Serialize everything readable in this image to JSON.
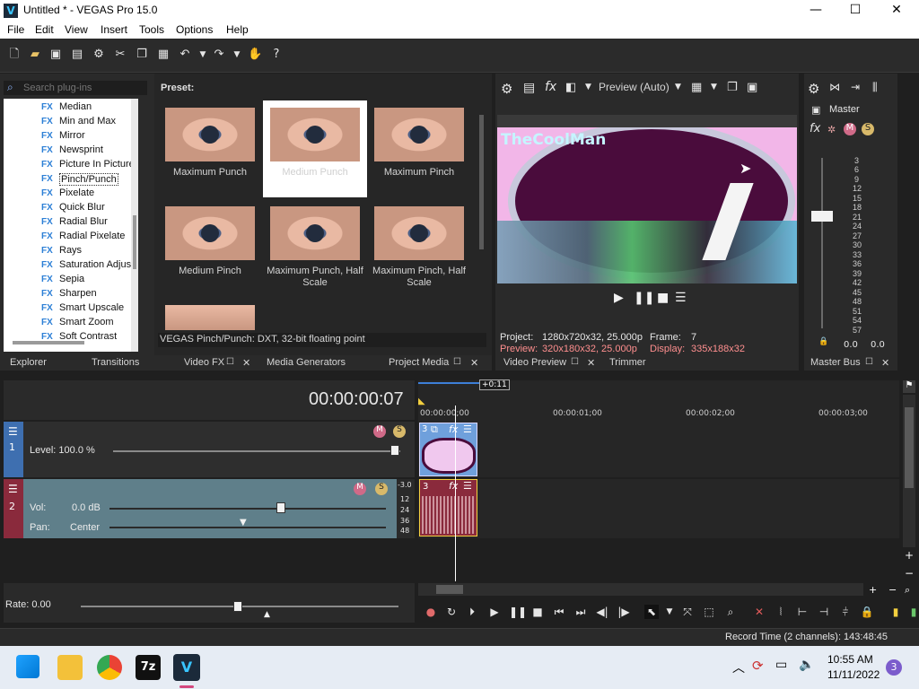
{
  "window": {
    "title": "Untitled * - VEGAS Pro 15.0",
    "logo_letter": "V",
    "controls": {
      "minimize": "—",
      "maximize": "☐",
      "close": "✕"
    }
  },
  "menu": [
    "File",
    "Edit",
    "View",
    "Insert",
    "Tools",
    "Options",
    "Help"
  ],
  "plugins": {
    "search_placeholder": "Search plug-ins",
    "fx_badge": "FX",
    "items": [
      "Median",
      "Min and Max",
      "Mirror",
      "Newsprint",
      "Picture In Picture",
      "Pinch/Punch",
      "Pixelate",
      "Quick Blur",
      "Radial Blur",
      "Radial Pixelate",
      "Rays",
      "Saturation Adjust",
      "Sepia",
      "Sharpen",
      "Smart Upscale",
      "Smart Zoom",
      "Soft Contrast"
    ],
    "selected": "Pinch/Punch"
  },
  "presets": {
    "header": "Preset:",
    "tiles": [
      "Maximum Punch",
      "Medium Punch",
      "Maximum Pinch",
      "Medium Pinch",
      "Maximum Punch, Half Scale",
      "Maximum Pinch, Half Scale"
    ],
    "selected": "Medium Punch",
    "status": "VEGAS Pinch/Punch: DXT, 32-bit floating point"
  },
  "bottom_tabs_left": [
    "Explorer",
    "Transitions",
    "Video FX",
    "Media Generators",
    "Project Media"
  ],
  "preview": {
    "quality": "Preview (Auto)",
    "overlay_text": "TheCoolMan",
    "project_label": "Project:",
    "project_value": "1280x720x32, 25.000p",
    "preview_label": "Preview:",
    "preview_value": "320x180x32, 25.000p",
    "frame_label": "Frame:",
    "frame_value": "7",
    "display_label": "Display:",
    "display_value": "335x188x32",
    "tabs": [
      "Video Preview",
      "Trimmer"
    ]
  },
  "master": {
    "label": "Master",
    "scale": [
      "3",
      "6",
      "9",
      "12",
      "15",
      "18",
      "21",
      "24",
      "27",
      "30",
      "33",
      "36",
      "39",
      "42",
      "45",
      "48",
      "51",
      "54",
      "57"
    ],
    "left_value": "0.0",
    "right_value": "0.0",
    "tab": "Master Bus"
  },
  "timeline": {
    "timecode": "00:00:00:07",
    "cursor_badge": "+0:11",
    "ruler": [
      "00:00:00;00",
      "00:00:01;00",
      "00:00:02;00",
      "00:00:03;00"
    ],
    "video_track": {
      "number": "1",
      "level_label": "Level: 100.0 %",
      "level_percent": 100
    },
    "audio_track": {
      "number": "2",
      "vol_label": "Vol:",
      "vol_value": "0.0 dB",
      "pan_label": "Pan:",
      "pan_value": "Center",
      "meter_top": "-3.0",
      "meter_scale": [
        "12",
        "24",
        "36",
        "48"
      ]
    },
    "video_event_number": "3",
    "audio_event_number": "3",
    "rate_label": "Rate: 0.00"
  },
  "status_bar": "Record Time (2 channels): 143:48:45",
  "taskbar": {
    "time": "10:55 AM",
    "date": "11/11/2022",
    "notifications": "3",
    "app_7z": "7z",
    "app_vegas": "V"
  }
}
